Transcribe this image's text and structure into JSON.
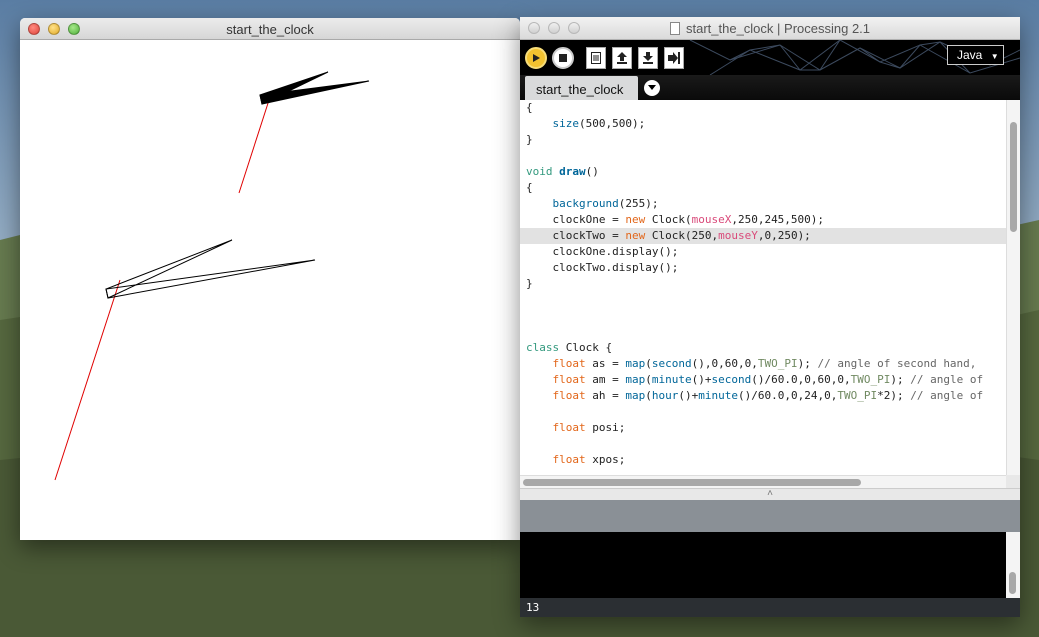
{
  "sketch_window": {
    "title": "start_the_clock"
  },
  "ide_window": {
    "title": "start_the_clock | Processing 2.1",
    "mode": "Java",
    "tab_label": "start_the_clock",
    "status_line": "13"
  },
  "code_lines": [
    "{",
    "    size(500,500);",
    "}",
    "",
    "void draw()",
    "{",
    "    background(255);",
    "    clockOne = new Clock(mouseX,250,245,500);",
    "    clockTwo = new Clock(250,mouseY,0,250);",
    "    clockOne.display();",
    "    clockTwo.display();",
    "}",
    "",
    "",
    "",
    "class Clock {",
    "    float as = map(second(),0,60,0,TWO_PI); // angle of second hand,",
    "    float am = map(minute()+second()/60.0,0,60,0,TWO_PI); // angle of",
    "    float ah = map(hour()+minute()/60.0,0,24,0,TWO_PI*2); // angle of",
    "",
    "    float posi;",
    "",
    "    float xpos;"
  ],
  "colors": {
    "accent_run": "#f2c230",
    "second_hand": "#e00000",
    "highlight_line": "#e2e2e2"
  }
}
